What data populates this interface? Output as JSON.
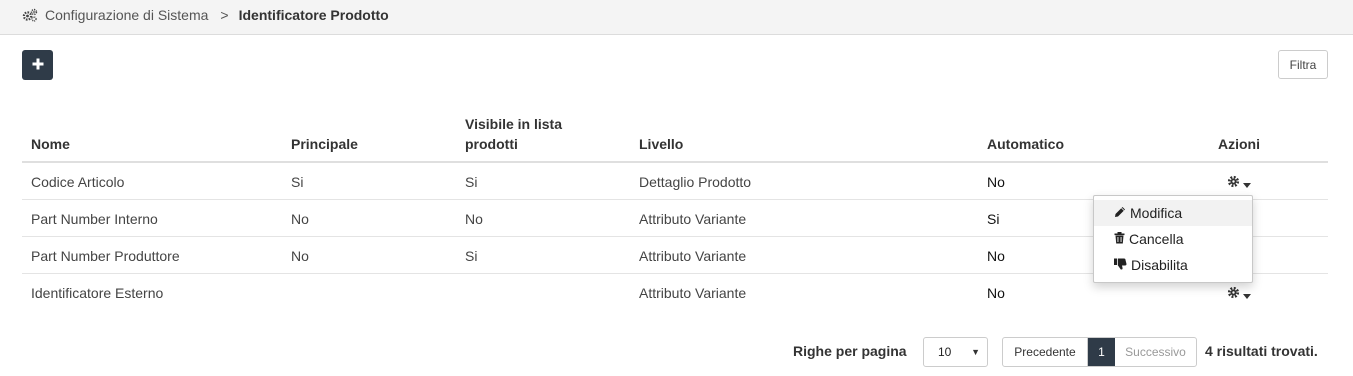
{
  "breadcrumb": {
    "icon": "cogs-icon",
    "parent": "Configurazione di Sistema",
    "separator": ">",
    "current": "Identificatore Prodotto"
  },
  "toolbar": {
    "add_icon": "plus-icon",
    "filter_label": "Filtra"
  },
  "table": {
    "headers": {
      "nome": "Nome",
      "principale": "Principale",
      "visibile_line1": "Visibile in lista",
      "visibile_line2": "prodotti",
      "livello": "Livello",
      "automatico": "Automatico",
      "azioni": "Azioni"
    },
    "rows": [
      {
        "nome": "Codice Articolo",
        "principale": "Si",
        "visibile": "Si",
        "livello": "Dettaglio Prodotto",
        "automatico": "No"
      },
      {
        "nome": "Part Number Interno",
        "principale": "No",
        "visibile": "No",
        "livello": "Attributo Variante",
        "automatico": "Si"
      },
      {
        "nome": "Part Number Produttore",
        "principale": "No",
        "visibile": "Si",
        "livello": "Attributo Variante",
        "automatico": "No"
      },
      {
        "nome": "Identificatore Esterno",
        "principale": "",
        "visibile": "",
        "livello": "Attributo Variante",
        "automatico": "No"
      }
    ]
  },
  "actions_menu": {
    "items": [
      {
        "label": "Modifica",
        "icon": "pencil-icon"
      },
      {
        "label": "Cancella",
        "icon": "trash-icon"
      },
      {
        "label": "Disabilita",
        "icon": "thumbs-down-icon"
      }
    ]
  },
  "pagination": {
    "rows_per_page_label": "Righe per pagina",
    "rows_per_page_value": "10",
    "prev_label": "Precedente",
    "current_page": "1",
    "next_label": "Successivo",
    "results_text": "4 risultati trovati."
  },
  "colors": {
    "dark_button": "#2f3b48",
    "header_bg": "#f4f4f4"
  }
}
